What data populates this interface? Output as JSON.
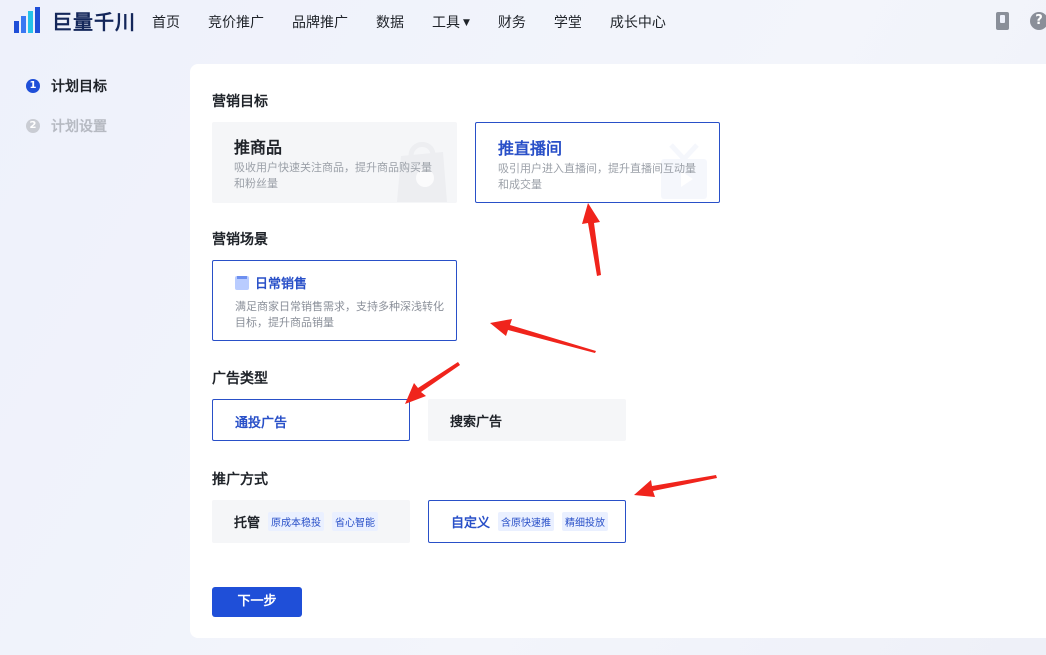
{
  "app": {
    "logo_text": "巨量千川"
  },
  "nav": {
    "items": [
      "首页",
      "竞价推广",
      "品牌推广",
      "数据",
      "工具",
      "财务",
      "学堂",
      "成长中心"
    ],
    "tools_caret": "▼"
  },
  "top_icons": {
    "help": "?"
  },
  "steps": [
    {
      "num": "1",
      "label": "计划目标"
    },
    {
      "num": "2",
      "label": "计划设置"
    }
  ],
  "sections": {
    "goal": {
      "title": "营销目标",
      "cards": [
        {
          "title": "推商品",
          "desc": "吸收用户快速关注商品，提升商品购买量和粉丝量"
        },
        {
          "title": "推直播间",
          "desc": "吸引用户进入直播间，提升直播间互动量和成交量"
        }
      ]
    },
    "scene": {
      "title": "营销场景",
      "card": {
        "title": "日常销售",
        "desc": "满足商家日常销售需求，支持多种深浅转化目标，提升商品销量"
      }
    },
    "ad_type": {
      "title": "广告类型",
      "options": [
        "通投广告",
        "搜索广告"
      ]
    },
    "method": {
      "title": "推广方式",
      "options": [
        {
          "label": "托管",
          "tags": [
            "原成本稳投",
            "省心智能"
          ]
        },
        {
          "label": "自定义",
          "tags": [
            "含原快速推",
            "精细投放"
          ]
        }
      ]
    }
  },
  "next_button": "下一步",
  "colors": {
    "accent": "#1f4fd8",
    "selected_border": "#2950c8",
    "annotation_arrow": "#f0241c"
  }
}
